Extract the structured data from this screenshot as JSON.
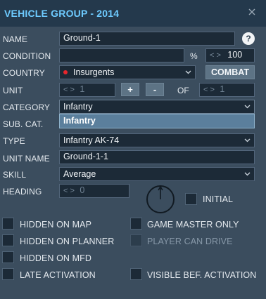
{
  "window": {
    "title": "VEHICLE GROUP - 2014"
  },
  "fields": {
    "name": {
      "label": "NAME",
      "value": "Ground-1"
    },
    "condition": {
      "label": "CONDITION",
      "value": "",
      "unit": "%",
      "spin_value": "100"
    },
    "country": {
      "label": "COUNTRY",
      "value": "Insurgents",
      "combat_label": "COMBAT"
    },
    "unit": {
      "label": "UNIT",
      "value": "1",
      "plus": "+",
      "minus": "-",
      "of_label": "OF",
      "of_value": "1"
    },
    "category": {
      "label": "CATEGORY",
      "value": "Infantry",
      "dropdown_option": "Infantry"
    },
    "subcat": {
      "label": "SUB. CAT."
    },
    "type": {
      "label": "TYPE",
      "value": "Infantry AK-74"
    },
    "unit_name": {
      "label": "UNIT NAME",
      "value": "Ground-1-1"
    },
    "skill": {
      "label": "SKILL",
      "value": "Average"
    },
    "heading": {
      "label": "HEADING",
      "value": "0",
      "initial_label": "INITIAL"
    }
  },
  "spinner_arrows": "< >",
  "options": [
    {
      "label": "HIDDEN ON MAP",
      "enabled": true
    },
    {
      "label": "GAME MASTER ONLY",
      "enabled": true
    },
    {
      "label": "HIDDEN ON PLANNER",
      "enabled": true
    },
    {
      "label": "PLAYER CAN DRIVE",
      "enabled": false
    },
    {
      "label": "HIDDEN ON MFD",
      "enabled": true
    },
    {
      "label": "LATE ACTIVATION",
      "enabled": true
    },
    {
      "label": "VISIBLE BEF. ACTIVATION",
      "enabled": true
    }
  ],
  "help_symbol": "?",
  "colors": {
    "title": "#6ecbff",
    "accent_dropdown": "#5b7f9c",
    "country_dot": "#e8262c"
  }
}
